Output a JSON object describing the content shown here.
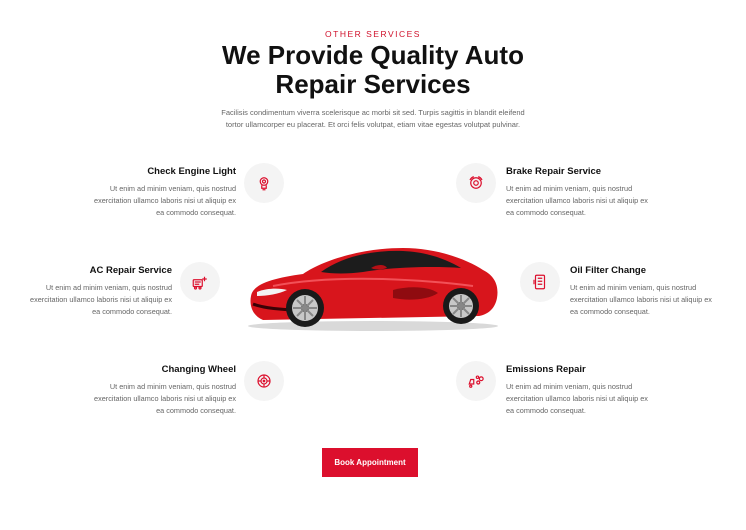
{
  "header": {
    "eyebrow": "OTHER SERVICES",
    "title_line1": "We Provide Quality Auto",
    "title_line2": "Repair Services",
    "intro_line1": "Facilisis condimentum viverra scelerisque ac morbi sit sed. Turpis sagittis in blandit eleifend",
    "intro_line2": "tortor ullamcorper eu placerat. Et orci felis volutpat, etiam vitae egestas volutpat pulvinar."
  },
  "services": {
    "check_engine": {
      "title": "Check Engine Light",
      "line1": "Ut enim ad minim veniam, quis nostrud",
      "line2": "exercitation ullamco laboris nisi ut aliquip ex",
      "line3": "ea commodo consequat.",
      "icon": "engine-light-icon"
    },
    "ac_repair": {
      "title": "AC Repair Service",
      "line1": "Ut enim ad minim veniam, quis nostrud",
      "line2": "exercitation ullamco laboris nisi ut aliquip ex",
      "line3": "ea commodo consequat.",
      "icon": "ac-icon"
    },
    "changing_wheel": {
      "title": "Changing Wheel",
      "line1": "Ut enim ad minim veniam, quis nostrud",
      "line2": "exercitation ullamco laboris nisi ut aliquip ex",
      "line3": "ea commodo consequat.",
      "icon": "wheel-icon"
    },
    "brake_repair": {
      "title": "Brake Repair Service",
      "line1": "Ut enim ad minim veniam, quis nostrud",
      "line2": "exercitation ullamco laboris nisi ut aliquip ex",
      "line3": "ea commodo consequat.",
      "icon": "brake-icon"
    },
    "oil_filter": {
      "title": "Oil Filter Change",
      "line1": "Ut enim ad minim veniam, quis nostrud",
      "line2": "exercitation ullamco laboris nisi ut aliquip ex",
      "line3": "ea commodo consequat.",
      "icon": "oil-filter-icon"
    },
    "emissions": {
      "title": "Emissions Repair",
      "line1": "Ut enim ad minim veniam, quis nostrud",
      "line2": "exercitation ullamco laboris nisi ut aliquip ex",
      "line3": "ea commodo consequat.",
      "icon": "emissions-icon"
    }
  },
  "cta": {
    "label": "Book Appointment"
  },
  "colors": {
    "accent": "#dc0f2d",
    "icon_bg": "#f4f4f4",
    "car_body": "#d8151c"
  }
}
